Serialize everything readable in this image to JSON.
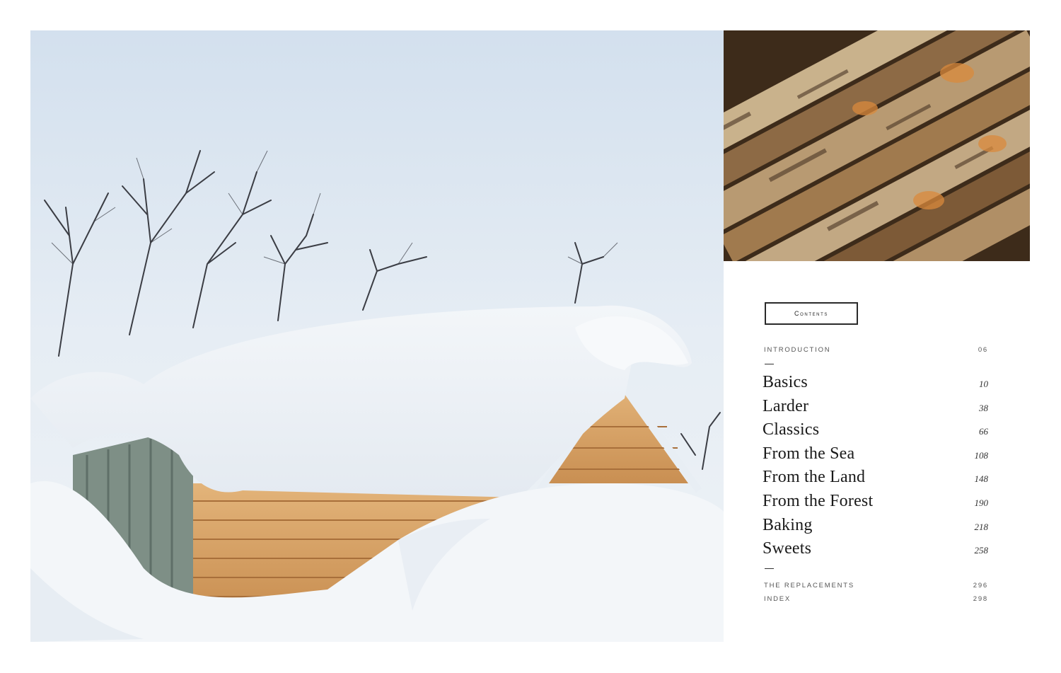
{
  "contents": {
    "heading": "Contents",
    "intro": {
      "label": "INTRODUCTION",
      "page": "06"
    },
    "chapters": [
      {
        "title": "Basics",
        "page": "10"
      },
      {
        "title": "Larder",
        "page": "38"
      },
      {
        "title": "Classics",
        "page": "66"
      },
      {
        "title": "From the Sea",
        "page": "108"
      },
      {
        "title": "From the Land",
        "page": "148"
      },
      {
        "title": "From the Forest",
        "page": "190"
      },
      {
        "title": "Baking",
        "page": "218"
      },
      {
        "title": "Sweets",
        "page": "258"
      }
    ],
    "back_matter": [
      {
        "label": "THE REPLACEMENTS",
        "page": "296"
      },
      {
        "label": "INDEX",
        "page": "298"
      }
    ]
  },
  "images": {
    "main": "snow-covered-log-cabin-photo",
    "secondary": "stacked-birch-firewood-photo"
  },
  "colors": {
    "sky": "#dfe8f1",
    "snow": "#f4f7fa",
    "wood": "#d9a66a",
    "text": "#1f1f1f"
  }
}
